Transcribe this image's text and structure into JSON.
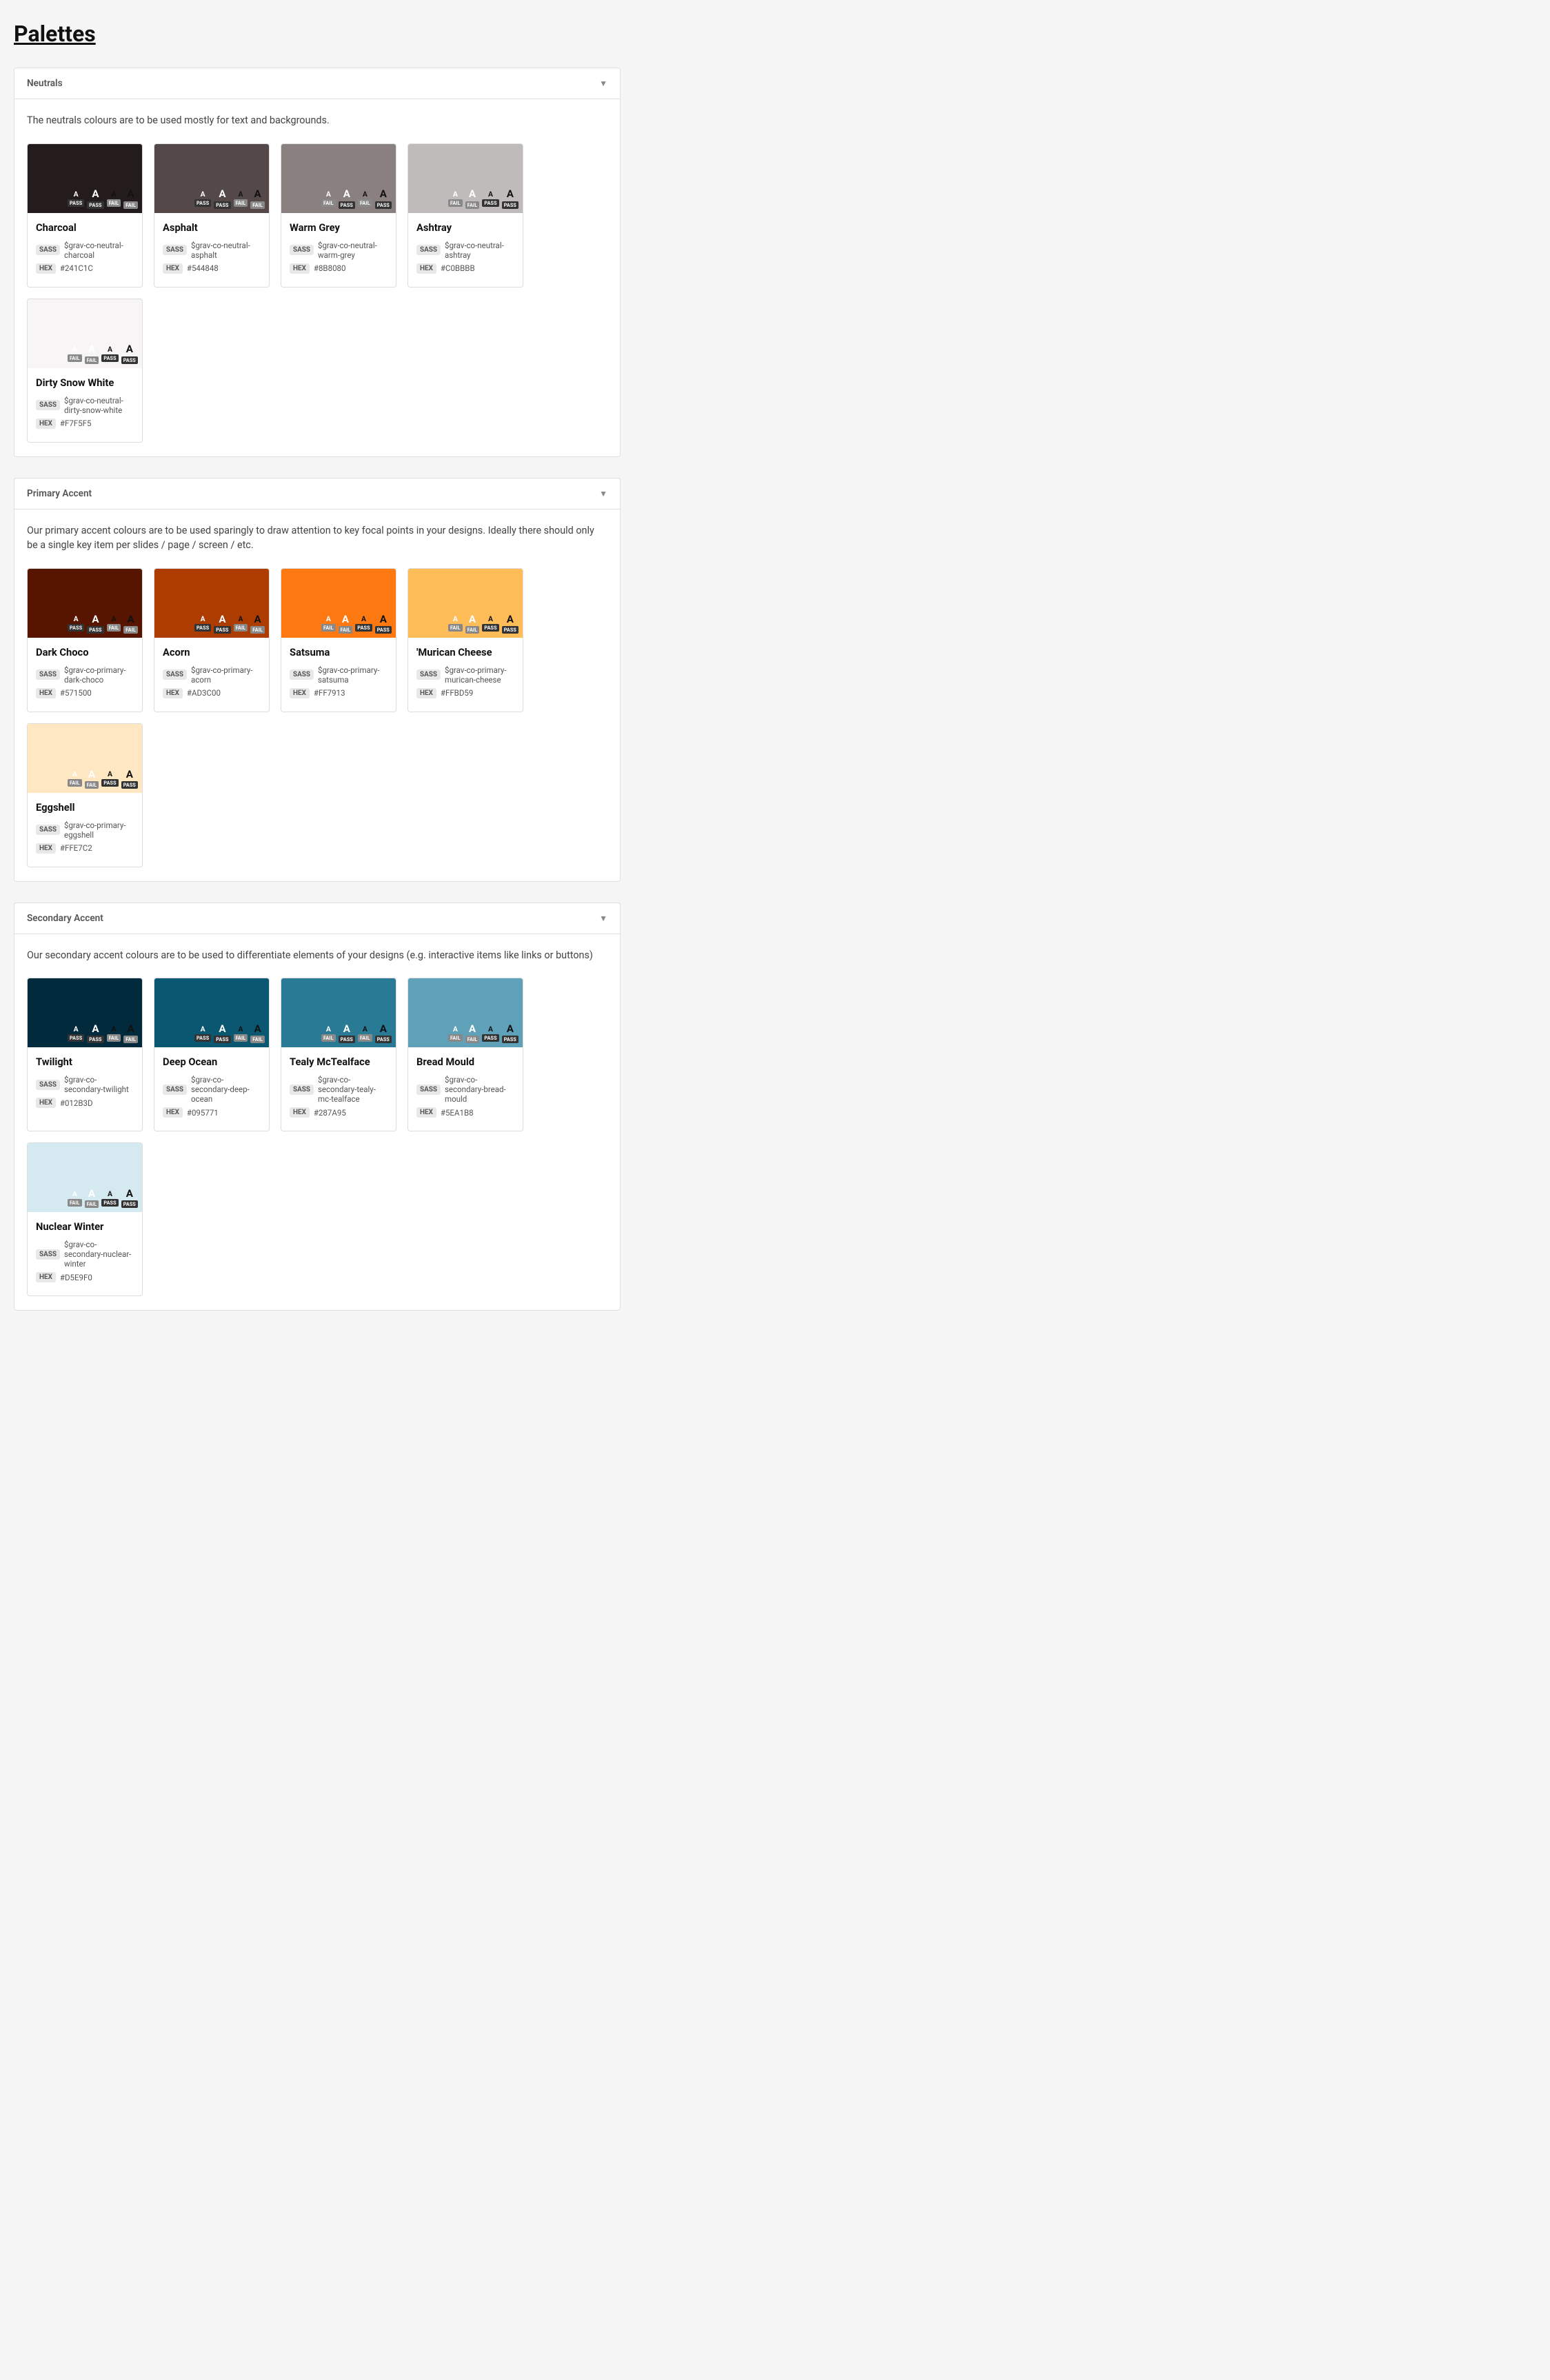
{
  "page": {
    "title": "Palettes"
  },
  "sections": [
    {
      "id": "neutrals",
      "title": "Neutrals",
      "description": "The neutrals colours are to be used mostly for text and backgrounds.",
      "colors": [
        {
          "name": "Charcoal",
          "hex": "#241C1C",
          "hex_display": "#241C1C",
          "sass": "$grav-co-neutral-charcoal",
          "swatch_bg": "#241C1C",
          "acc": [
            {
              "letter": "A",
              "size": "small",
              "color": "white",
              "on_dark": true,
              "pass": true
            },
            {
              "letter": "A",
              "size": "large",
              "color": "white",
              "on_dark": true,
              "pass": true
            },
            {
              "letter": "A",
              "size": "small",
              "color": "black",
              "on_dark": true,
              "pass": false
            },
            {
              "letter": "A",
              "size": "large",
              "color": "black",
              "on_dark": true,
              "pass": false
            }
          ]
        },
        {
          "name": "Asphalt",
          "hex": "#544848",
          "hex_display": "#544848",
          "sass": "$grav-co-neutral-asphalt",
          "swatch_bg": "#544848",
          "acc": [
            {
              "letter": "A",
              "size": "small",
              "color": "white",
              "on_dark": true,
              "pass": true
            },
            {
              "letter": "A",
              "size": "large",
              "color": "white",
              "on_dark": true,
              "pass": true
            },
            {
              "letter": "A",
              "size": "small",
              "color": "black",
              "on_dark": true,
              "pass": false
            },
            {
              "letter": "A",
              "size": "large",
              "color": "black",
              "on_dark": true,
              "pass": false
            }
          ]
        },
        {
          "name": "Warm Grey",
          "hex": "#8B8080",
          "hex_display": "#8B8080",
          "sass": "$grav-co-neutral-warm-grey",
          "swatch_bg": "#8B8080",
          "acc": [
            {
              "letter": "A",
              "size": "small",
              "color": "white",
              "on_dark": true,
              "pass": false
            },
            {
              "letter": "A",
              "size": "large",
              "color": "white",
              "on_dark": true,
              "pass": true
            },
            {
              "letter": "A",
              "size": "small",
              "color": "black",
              "on_dark": true,
              "pass": false
            },
            {
              "letter": "A",
              "size": "large",
              "color": "black",
              "on_dark": true,
              "pass": true
            }
          ]
        },
        {
          "name": "Ashtray",
          "hex": "#C0BBBB",
          "hex_display": "#C0BBBB",
          "sass": "$grav-co-neutral-ashtray",
          "swatch_bg": "#C0BBBB",
          "acc": [
            {
              "letter": "A",
              "size": "small",
              "color": "white",
              "on_dark": false,
              "pass": false
            },
            {
              "letter": "A",
              "size": "large",
              "color": "white",
              "on_dark": false,
              "pass": false
            },
            {
              "letter": "A",
              "size": "small",
              "color": "black",
              "on_dark": false,
              "pass": true
            },
            {
              "letter": "A",
              "size": "large",
              "color": "black",
              "on_dark": false,
              "pass": true
            }
          ]
        },
        {
          "name": "Dirty Snow White",
          "hex": "#F7F5F5",
          "hex_display": "#F7F5F5",
          "sass": "$grav-co-neutral-dirty-snow-white",
          "swatch_bg": "#F7F5F5",
          "acc": [
            {
              "letter": "A",
              "size": "small",
              "color": "white",
              "on_dark": false,
              "pass": false
            },
            {
              "letter": "A",
              "size": "large",
              "color": "white",
              "on_dark": false,
              "pass": false
            },
            {
              "letter": "A",
              "size": "small",
              "color": "black",
              "on_dark": false,
              "pass": true
            },
            {
              "letter": "A",
              "size": "large",
              "color": "black",
              "on_dark": false,
              "pass": true
            }
          ]
        }
      ]
    },
    {
      "id": "primary-accent",
      "title": "Primary Accent",
      "description": "Our primary accent colours are to be used sparingly to draw attention to key focal points in your designs. Ideally there should only be a single key item per slides / page / screen / etc.",
      "colors": [
        {
          "name": "Dark Choco",
          "hex": "#571500",
          "hex_display": "#571500",
          "sass": "$grav-co-primary-dark-choco",
          "swatch_bg": "#571500",
          "acc": [
            {
              "letter": "A",
              "size": "small",
              "color": "white",
              "on_dark": true,
              "pass": true
            },
            {
              "letter": "A",
              "size": "large",
              "color": "white",
              "on_dark": true,
              "pass": true
            },
            {
              "letter": "A",
              "size": "small",
              "color": "black",
              "on_dark": true,
              "pass": false
            },
            {
              "letter": "A",
              "size": "large",
              "color": "black",
              "on_dark": true,
              "pass": false
            }
          ]
        },
        {
          "name": "Acorn",
          "hex": "#AD3C00",
          "hex_display": "#AD3C00",
          "sass": "$grav-co-primary-acorn",
          "swatch_bg": "#AD3C00",
          "acc": [
            {
              "letter": "A",
              "size": "small",
              "color": "white",
              "on_dark": true,
              "pass": true
            },
            {
              "letter": "A",
              "size": "large",
              "color": "white",
              "on_dark": true,
              "pass": true
            },
            {
              "letter": "A",
              "size": "small",
              "color": "black",
              "on_dark": true,
              "pass": false
            },
            {
              "letter": "A",
              "size": "large",
              "color": "black",
              "on_dark": true,
              "pass": false
            }
          ]
        },
        {
          "name": "Satsuma",
          "hex": "#FF7913",
          "hex_display": "#FF7913",
          "sass": "$grav-co-primary-satsuma",
          "swatch_bg": "#FF7913",
          "acc": [
            {
              "letter": "A",
              "size": "small",
              "color": "white",
              "on_dark": true,
              "pass": false
            },
            {
              "letter": "A",
              "size": "large",
              "color": "white",
              "on_dark": true,
              "pass": false
            },
            {
              "letter": "A",
              "size": "small",
              "color": "black",
              "on_dark": true,
              "pass": true
            },
            {
              "letter": "A",
              "size": "large",
              "color": "black",
              "on_dark": true,
              "pass": true
            }
          ]
        },
        {
          "name": "'Murican Cheese",
          "hex": "#FFBD59",
          "hex_display": "#FFBD59",
          "sass": "$grav-co-primary-murican-cheese",
          "swatch_bg": "#FFBD59",
          "acc": [
            {
              "letter": "A",
              "size": "small",
              "color": "white",
              "on_dark": false,
              "pass": false
            },
            {
              "letter": "A",
              "size": "large",
              "color": "white",
              "on_dark": false,
              "pass": false
            },
            {
              "letter": "A",
              "size": "small",
              "color": "black",
              "on_dark": false,
              "pass": true
            },
            {
              "letter": "A",
              "size": "large",
              "color": "black",
              "on_dark": false,
              "pass": true
            }
          ]
        },
        {
          "name": "Eggshell",
          "hex": "#FFE7C2",
          "hex_display": "#FFE7C2",
          "sass": "$grav-co-primary-eggshell",
          "swatch_bg": "#FFE7C2",
          "acc": [
            {
              "letter": "A",
              "size": "small",
              "color": "white",
              "on_dark": false,
              "pass": false
            },
            {
              "letter": "A",
              "size": "large",
              "color": "white",
              "on_dark": false,
              "pass": false
            },
            {
              "letter": "A",
              "size": "small",
              "color": "black",
              "on_dark": false,
              "pass": true
            },
            {
              "letter": "A",
              "size": "large",
              "color": "black",
              "on_dark": false,
              "pass": true
            }
          ]
        }
      ]
    },
    {
      "id": "secondary-accent",
      "title": "Secondary Accent",
      "description": "Our secondary accent colours are to be used to differentiate elements of your designs (e.g. interactive items like links or buttons)",
      "colors": [
        {
          "name": "Twilight",
          "hex": "#012B3D",
          "hex_display": "#012B3D",
          "sass": "$grav-co-secondary-twilight",
          "swatch_bg": "#012B3D",
          "acc": [
            {
              "letter": "A",
              "size": "small",
              "color": "white",
              "on_dark": true,
              "pass": true
            },
            {
              "letter": "A",
              "size": "large",
              "color": "white",
              "on_dark": true,
              "pass": true
            },
            {
              "letter": "A",
              "size": "small",
              "color": "black",
              "on_dark": true,
              "pass": false
            },
            {
              "letter": "A",
              "size": "large",
              "color": "black",
              "on_dark": true,
              "pass": false
            }
          ]
        },
        {
          "name": "Deep Ocean",
          "hex": "#095771",
          "hex_display": "#095771",
          "sass": "$grav-co-secondary-deep-ocean",
          "swatch_bg": "#095771",
          "acc": [
            {
              "letter": "A",
              "size": "small",
              "color": "white",
              "on_dark": true,
              "pass": true
            },
            {
              "letter": "A",
              "size": "large",
              "color": "white",
              "on_dark": true,
              "pass": true
            },
            {
              "letter": "A",
              "size": "small",
              "color": "black",
              "on_dark": true,
              "pass": false
            },
            {
              "letter": "A",
              "size": "large",
              "color": "black",
              "on_dark": true,
              "pass": false
            }
          ]
        },
        {
          "name": "Tealy McTealface",
          "hex": "#287A95",
          "hex_display": "#287A95",
          "sass": "$grav-co-secondary-tealy-mc-tealface",
          "swatch_bg": "#287A95",
          "acc": [
            {
              "letter": "A",
              "size": "small",
              "color": "white",
              "on_dark": true,
              "pass": false
            },
            {
              "letter": "A",
              "size": "large",
              "color": "white",
              "on_dark": true,
              "pass": true
            },
            {
              "letter": "A",
              "size": "small",
              "color": "black",
              "on_dark": true,
              "pass": false
            },
            {
              "letter": "A",
              "size": "large",
              "color": "black",
              "on_dark": true,
              "pass": true
            }
          ]
        },
        {
          "name": "Bread Mould",
          "hex": "#5EA1B8",
          "hex_display": "#5EA1B8",
          "sass": "$grav-co-secondary-bread-mould",
          "swatch_bg": "#5EA1B8",
          "acc": [
            {
              "letter": "A",
              "size": "small",
              "color": "white",
              "on_dark": true,
              "pass": false
            },
            {
              "letter": "A",
              "size": "large",
              "color": "white",
              "on_dark": true,
              "pass": false
            },
            {
              "letter": "A",
              "size": "small",
              "color": "black",
              "on_dark": true,
              "pass": true
            },
            {
              "letter": "A",
              "size": "large",
              "color": "black",
              "on_dark": true,
              "pass": true
            }
          ]
        },
        {
          "name": "Nuclear Winter",
          "hex": "#D5E9F0",
          "hex_display": "#D5E9F0",
          "sass": "$grav-co-secondary-nuclear-winter",
          "swatch_bg": "#D5E9F0",
          "acc": [
            {
              "letter": "A",
              "size": "small",
              "color": "white",
              "on_dark": false,
              "pass": false
            },
            {
              "letter": "A",
              "size": "large",
              "color": "white",
              "on_dark": false,
              "pass": false
            },
            {
              "letter": "A",
              "size": "small",
              "color": "black",
              "on_dark": false,
              "pass": true
            },
            {
              "letter": "A",
              "size": "large",
              "color": "black",
              "on_dark": false,
              "pass": true
            }
          ]
        }
      ]
    }
  ]
}
